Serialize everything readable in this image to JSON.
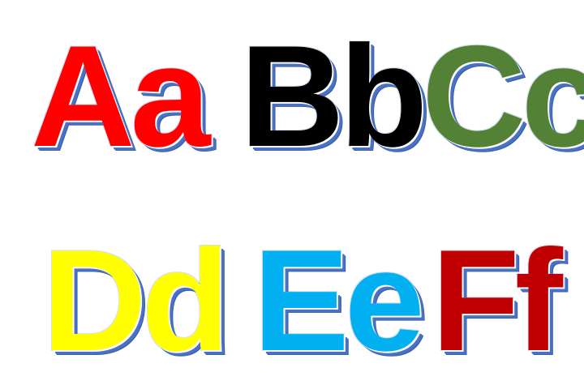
{
  "pairs": [
    {
      "text": "Aa",
      "color": "#ff0000"
    },
    {
      "text": "Bb",
      "color": "#000000"
    },
    {
      "text": "Cc",
      "color": "#538135"
    },
    {
      "text": "Dd",
      "color": "#ffff00"
    },
    {
      "text": "Ee",
      "color": "#00b0f0"
    },
    {
      "text": "Ff",
      "color": "#c00000"
    }
  ]
}
